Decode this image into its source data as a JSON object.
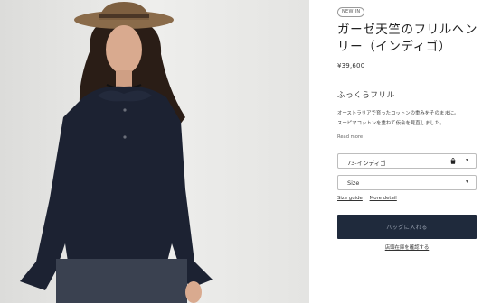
{
  "product": {
    "badge": "NEW IN",
    "title": "ガーゼ天竺のフリルヘンリー（インディゴ）",
    "price": "¥39,600",
    "subtitle": "ふっくらフリル",
    "description_line1": "オーストラリアで育ったコットンの重みをそのままに。",
    "description_line2": "スーピマコットンを重ねて仮会を見直しました。…",
    "read_more": "Read more"
  },
  "options": {
    "color_value": "73-インディゴ",
    "size_value": "Size",
    "chevron": "▾"
  },
  "links": {
    "size_guide": "Size guide",
    "more_detail": "More detail"
  },
  "actions": {
    "add_to_bag": "バッグに入れる",
    "check_store_stock": "店頭在庫を確認する"
  },
  "colors": {
    "button_bg": "#1f2a3c",
    "garment": "#1c2232",
    "photo_bg": "#e9e9e7"
  },
  "icons": {
    "bag": "shopping-bag-icon",
    "chevron": "chevron-down-icon"
  }
}
